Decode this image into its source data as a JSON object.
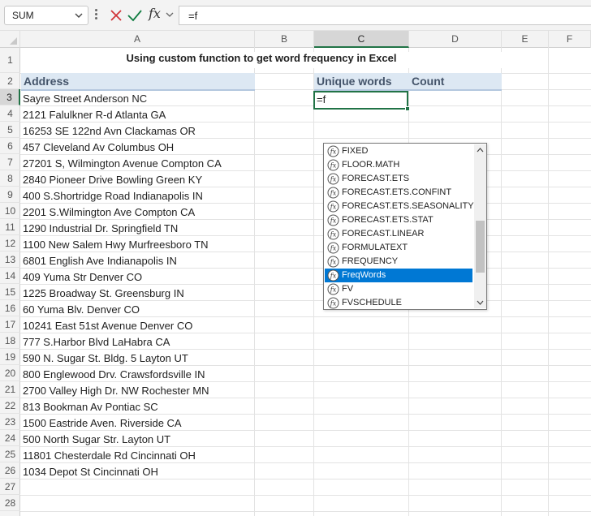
{
  "formula_bar": {
    "name_box": "SUM",
    "formula": "=f",
    "fx_label": "fx"
  },
  "columns": [
    "A",
    "B",
    "C",
    "D",
    "E",
    "F"
  ],
  "rows": [
    "1",
    "2",
    "3",
    "4",
    "5",
    "6",
    "7",
    "8",
    "9",
    "10",
    "11",
    "12",
    "13",
    "14",
    "15",
    "16",
    "17",
    "18",
    "19",
    "20",
    "21",
    "22",
    "23",
    "24",
    "25",
    "26",
    "27",
    "28"
  ],
  "sheet": {
    "title": "Using custom function to get word frequency in Excel",
    "header_address": "Address",
    "header_unique": "Unique words",
    "header_count": "Count",
    "active_cell_text": "=f",
    "addresses": [
      "Sayre Street  Anderson  NC",
      "2121 Falulkner R-d  Atlanta  GA",
      "16253 SE 122nd Avn  Clackamas  OR",
      "457 Cleveland Av  Columbus  OH",
      "27201 S, Wilmington Avenue  Compton  CA",
      "2840 Pioneer Drive  Bowling Green  KY",
      "400 S.Shortridge Road  Indianapolis  IN",
      "2201 S.Wilmington Ave  Compton  CA",
      "1290 Industrial Dr.  Springfield  TN",
      "1100 New Salem Hwy  Murfreesboro  TN",
      "6801 English Ave  Indianapolis  IN",
      "409 Yuma Str  Denver  CO",
      "1225  Broadway St.  Greensburg  IN",
      "60 Yuma Blv.  Denver  CO",
      "10241 East 51st Avenue  Denver  CO",
      "777 S.Harbor Blvd  LaHabra  CA",
      "590 N. Sugar St. Bldg. 5  Layton  UT",
      "800 Englewood Drv.  Crawsfordsville  IN",
      "2700 Valley High Dr. NW  Rochester  MN",
      "813 Bookman Av  Pontiac  SC",
      "1500 Eastride Aven.  Riverside  CA",
      "500 North Sugar Str.  Layton  UT",
      "11801 Chesterdale Rd  Cincinnati  OH",
      "1034 Depot St  Cincinnati  OH"
    ]
  },
  "autocomplete": {
    "items": [
      "FIXED",
      "FLOOR.MATH",
      "FORECAST.ETS",
      "FORECAST.ETS.CONFINT",
      "FORECAST.ETS.SEASONALITY",
      "FORECAST.ETS.STAT",
      "FORECAST.LINEAR",
      "FORMULATEXT",
      "FREQUENCY",
      "FreqWords",
      "FV",
      "FVSCHEDULE"
    ],
    "selected": "FreqWords",
    "icon": "function-icon"
  },
  "colors": {
    "accent_green": "#217346",
    "header_fill": "#dde8f3",
    "header_text": "#44546a",
    "selection_blue": "#0078d4"
  }
}
